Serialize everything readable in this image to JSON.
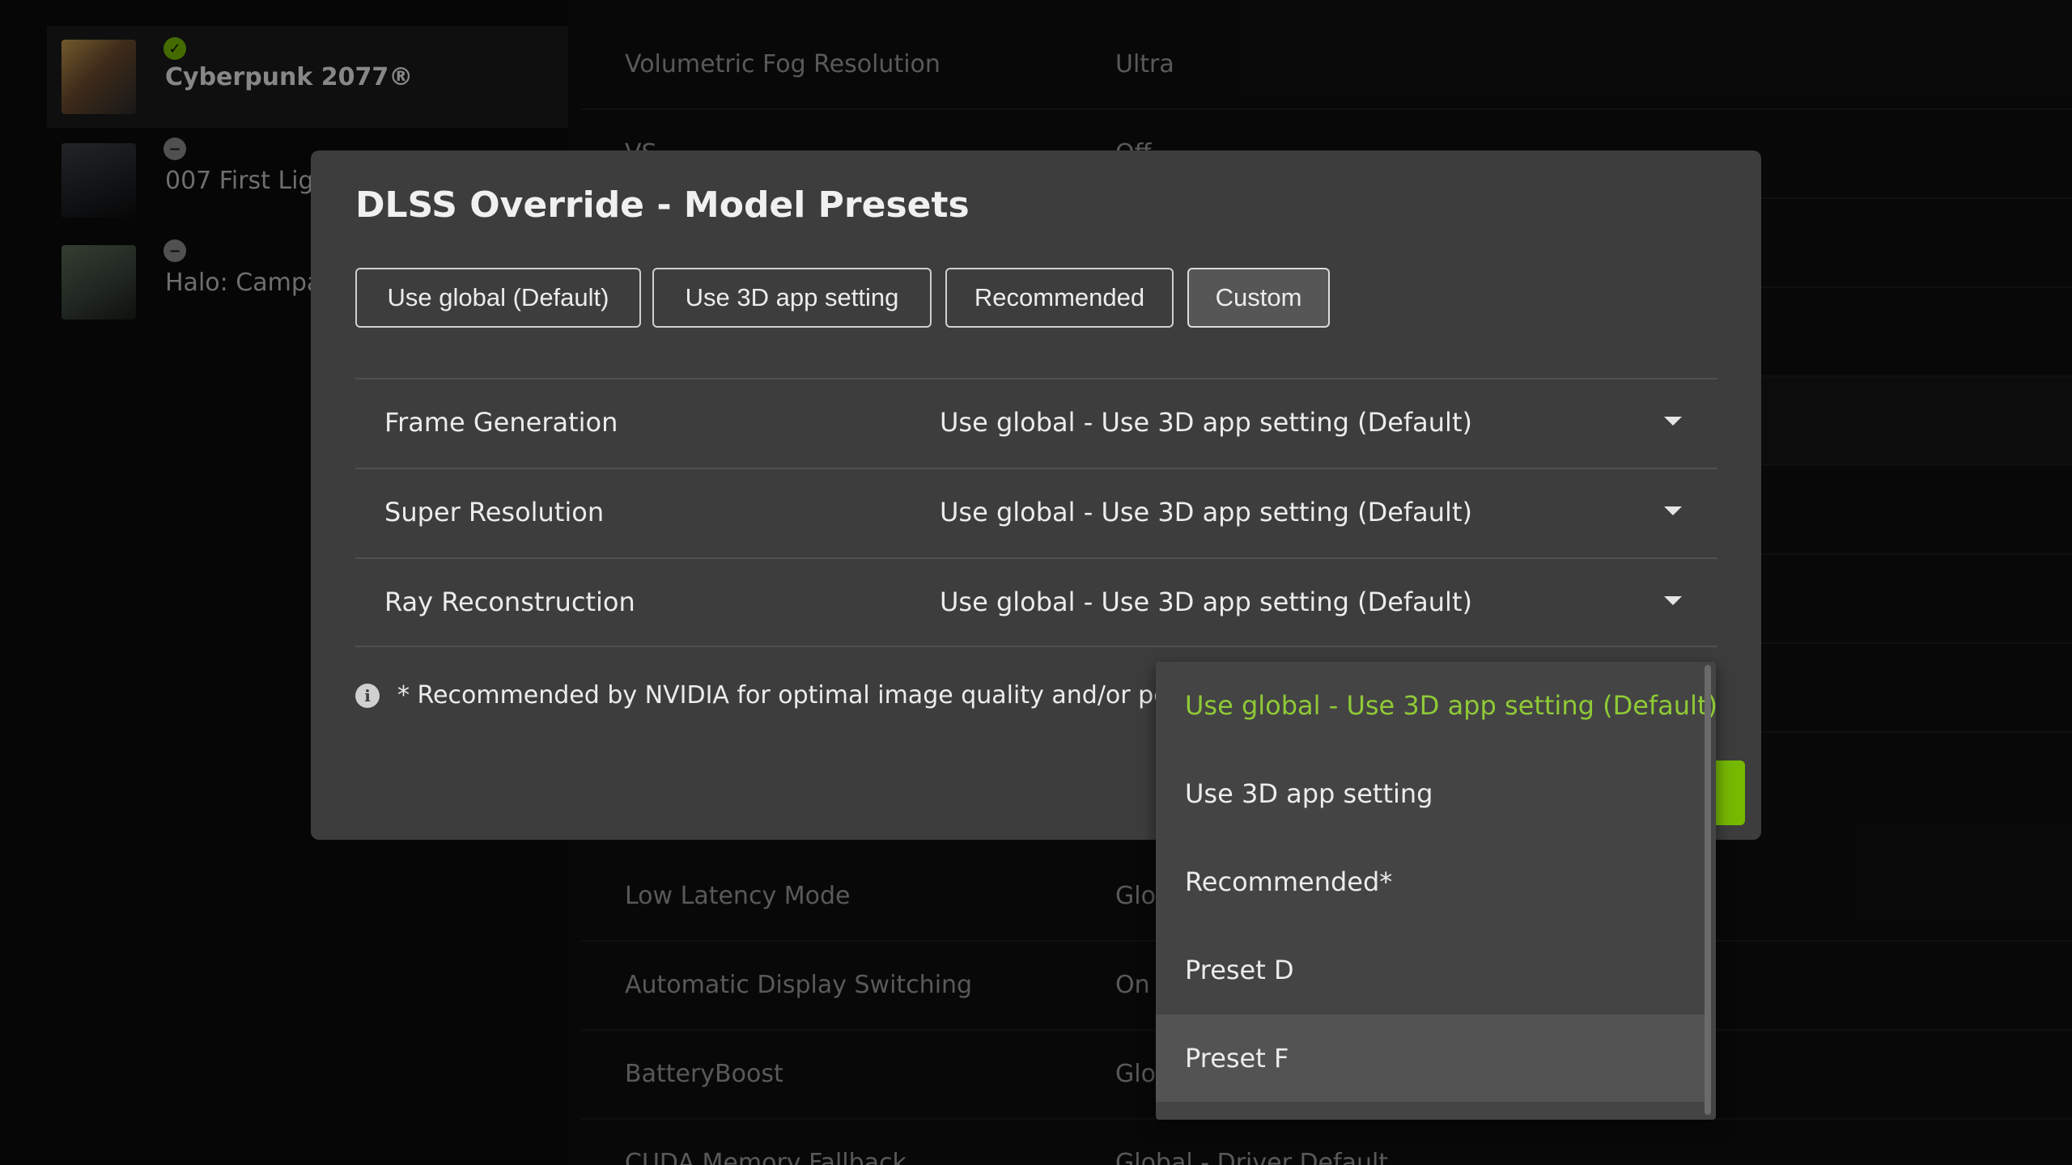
{
  "sidebar": {
    "games": [
      {
        "title": "Cyberpunk 2077®",
        "status": "check",
        "selected": true
      },
      {
        "title": "007 First Lig",
        "status": "minus",
        "selected": false
      },
      {
        "title": "Halo: Campa",
        "status": "minus",
        "selected": false
      }
    ]
  },
  "settings": {
    "rows": [
      {
        "label": "Volumetric Fog Resolution",
        "value": "Ultra"
      },
      {
        "label": "VS",
        "value": "Off"
      },
      {
        "label": "Low Latency Mode",
        "value": "Glob"
      },
      {
        "label": "Automatic Display Switching",
        "value": "On"
      },
      {
        "label": "BatteryBoost",
        "value": "Glob"
      },
      {
        "label": "CUDA Memory Fallback",
        "value": "Global - Driver Default"
      }
    ]
  },
  "modal": {
    "title": "DLSS Override - Model Presets",
    "tabs": [
      "Use global (Default)",
      "Use 3D app setting",
      "Recommended",
      "Custom"
    ],
    "active_tab": "Custom",
    "presets": [
      {
        "label": "Frame Generation",
        "value": "Use global - Use 3D app setting (Default)"
      },
      {
        "label": "Super Resolution",
        "value": "Use global - Use 3D app setting (Default)"
      },
      {
        "label": "Ray Reconstruction",
        "value": "Use global - Use 3D app setting (Default)"
      }
    ],
    "note": "* Recommended by NVIDIA for optimal image quality and/or per",
    "info_icon": "info-icon"
  },
  "dropdown": {
    "options": [
      "Use global - Use 3D app setting (Default)",
      "Use 3D app setting",
      "Recommended*",
      "Preset D",
      "Preset F"
    ],
    "selected_index": 0,
    "hover_index": 4
  },
  "colors": {
    "accent": "#76b900",
    "selected_text": "#8fca36",
    "modal_bg": "#3d3d3d",
    "dropdown_bg": "#444444"
  }
}
